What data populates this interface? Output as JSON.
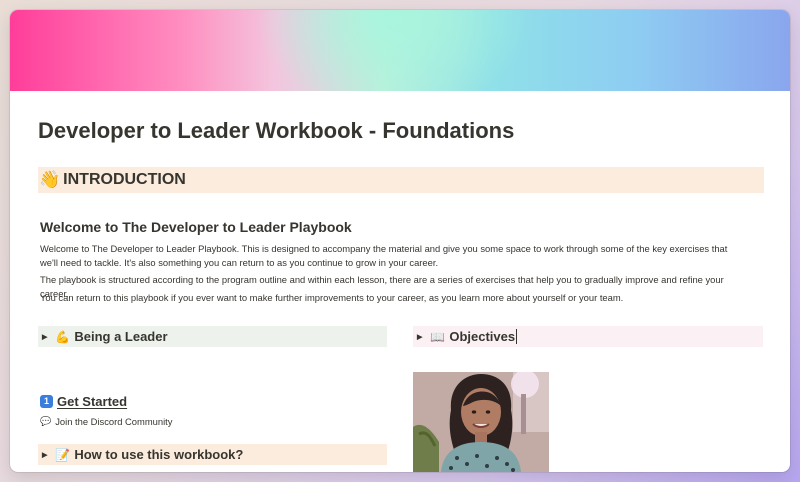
{
  "page": {
    "title": "Developer to Leader Workbook - Foundations"
  },
  "intro_heading": {
    "emoji": "👋",
    "text": "INTRODUCTION"
  },
  "welcome": {
    "heading": "Welcome to The Developer to Leader Playbook",
    "paragraphs": [
      "Welcome to The Developer to Leader Playbook. This is designed to accompany the material and give you some space to work through some of the key exercises that we'll need to tackle. It's also something you can return to as you continue to grow in your career.",
      "The playbook is structured according to the program outline and within each lesson, there are a series of exercises that help you to gradually improve and refine your career.",
      "You can return to this playbook if you ever want to make further improvements to your career, as you learn more about yourself or your team."
    ]
  },
  "toggles": {
    "being_leader": {
      "emoji": "💪",
      "label": "Being a Leader"
    },
    "objectives": {
      "emoji": "📖",
      "label": "Objectives"
    },
    "how_to_use": {
      "emoji": "📝",
      "label": "How to use this workbook?"
    }
  },
  "get_started": {
    "badge": "1",
    "label": "Get Started",
    "discord_link": "Join the Discord Community"
  },
  "colors": {
    "text": "#37352f",
    "intro_bg": "#fbecdd",
    "leader_bg": "#edf3ec",
    "objectives_bg": "#fbf1f4",
    "badge_blue": "#3b7ddd"
  }
}
